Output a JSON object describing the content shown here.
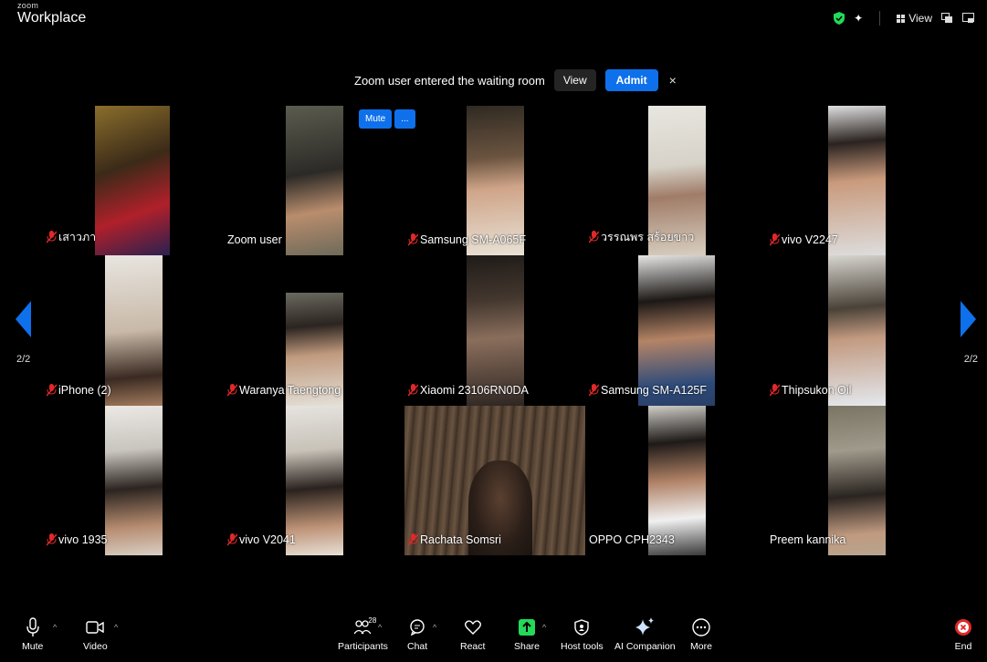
{
  "app": {
    "brand_small": "zoom",
    "brand_big": "Workplace"
  },
  "titlebar": {
    "view_label": "View"
  },
  "banner": {
    "message": "Zoom user entered the waiting room",
    "view_label": "View",
    "admit_label": "Admit",
    "close_label": "×"
  },
  "hover_controls": {
    "mute_label": "Mute",
    "more_label": "..."
  },
  "pager": {
    "left": "2/2",
    "right": "2/2"
  },
  "participants": [
    {
      "name": "เสาวภา",
      "muted": true
    },
    {
      "name": "Zoom user",
      "muted": false
    },
    {
      "name": "Samsung SM-A065F",
      "muted": true
    },
    {
      "name": "วรรณพร สร้อยขาว",
      "muted": true
    },
    {
      "name": "vivo V2247",
      "muted": true
    },
    {
      "name": "iPhone (2)",
      "muted": true
    },
    {
      "name": "Waranya Taengtong",
      "muted": true
    },
    {
      "name": "Xiaomi 23106RN0DA",
      "muted": true
    },
    {
      "name": "Samsung SM-A125F",
      "muted": true
    },
    {
      "name": "Thipsukon Oil",
      "muted": true
    },
    {
      "name": "vivo 1935",
      "muted": true
    },
    {
      "name": "vivo V2041",
      "muted": true
    },
    {
      "name": "Rachata Somsri",
      "muted": true
    },
    {
      "name": "OPPO CPH2343",
      "muted": false
    },
    {
      "name": "Preem kannika",
      "muted": false
    }
  ],
  "toolbar": {
    "mute": "Mute",
    "video": "Video",
    "participants": "Participants",
    "participants_count": "28",
    "chat": "Chat",
    "react": "React",
    "share": "Share",
    "host_tools": "Host tools",
    "ai_companion": "AI Companion",
    "more": "More",
    "end": "End"
  },
  "colors": {
    "accent": "#0e71eb",
    "share_green": "#23d959",
    "end_red": "#e02828",
    "mute_red": "#e02828"
  }
}
